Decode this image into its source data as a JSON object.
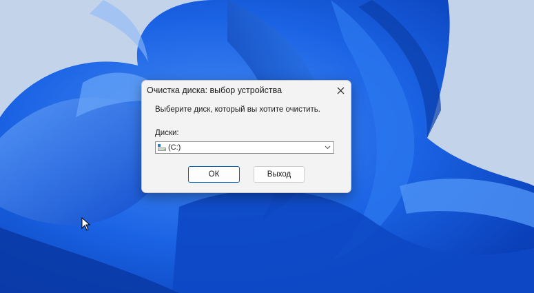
{
  "dialog": {
    "title": "Очистка диска: выбор устройства",
    "prompt": "Выберите диск, который вы хотите очистить.",
    "drives_label": "Диски:",
    "drive_selected": "(C:)",
    "ok_label": "ОК",
    "exit_label": "Выход"
  },
  "colors": {
    "wallpaper_bg": "#b9cde6",
    "bloom_blue": "#1560e0",
    "dialog_bg": "#f3f3f3",
    "default_button_border": "#0067c0"
  },
  "icons": [
    "close-icon",
    "drive-icon",
    "chevron-down-icon",
    "mouse-cursor"
  ]
}
